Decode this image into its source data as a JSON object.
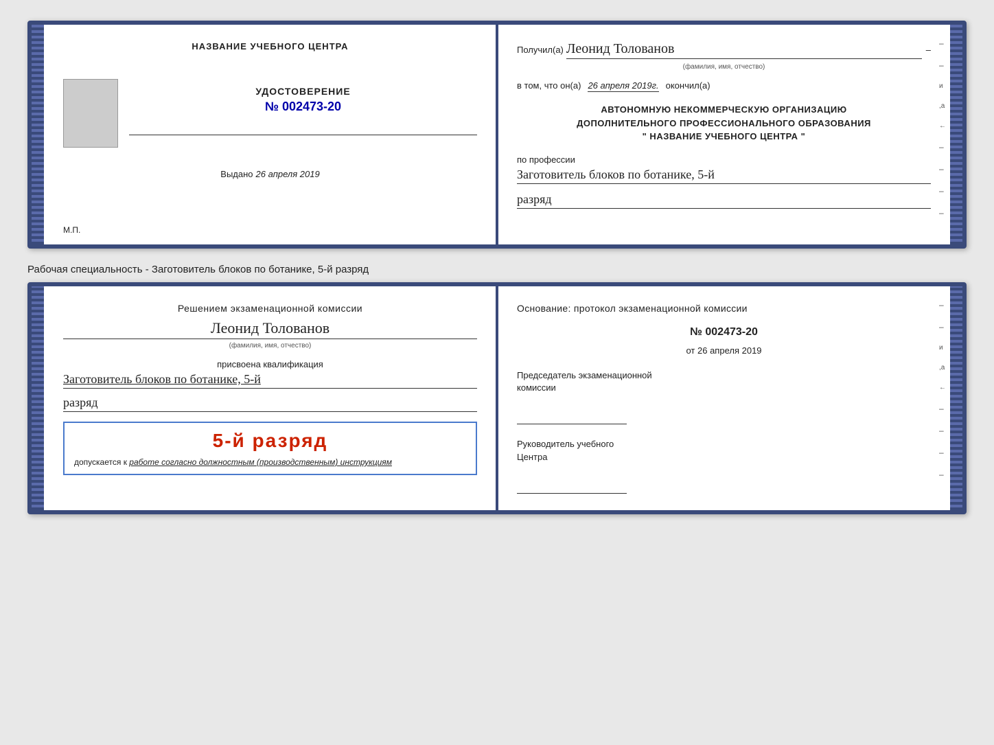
{
  "page": {
    "specialty_text": "Рабочая специальность - Заготовитель блоков по ботанике, 5-й разряд"
  },
  "cert1": {
    "left": {
      "center_name": "НАЗВАНИЕ УЧЕБНОГО ЦЕНТРА",
      "udostoverenie_title": "УДОСТОВЕРЕНИЕ",
      "number": "№ 002473-20",
      "vydano_label": "Выдано",
      "vydano_date": "26 апреля 2019",
      "mp": "М.П."
    },
    "right": {
      "poluchil_label": "Получил(а)",
      "fio_name": "Леонид Толованов",
      "fio_subtitle": "(фамилия, имя, отчество)",
      "v_tom_label": "в том, что он(а)",
      "v_tom_date": "26 апреля 2019г.",
      "okonchil_label": "окончил(а)",
      "autonomnuyu_line1": "АВТОНОМНУЮ НЕКОММЕРЧЕСКУЮ ОРГАНИЗАЦИЮ",
      "autonomnuyu_line2": "ДОПОЛНИТЕЛЬНОГО ПРОФЕССИОНАЛЬНОГО ОБРАЗОВАНИЯ",
      "autonomnuyu_line3": "\" НАЗВАНИЕ УЧЕБНОГО ЦЕНТРА \"",
      "po_professii_label": "по профессии",
      "profession_text": "Заготовитель блоков по ботанике, 5-й",
      "razryad_text": "разряд"
    }
  },
  "cert2": {
    "left": {
      "resheniem_title": "Решением экзаменационной комиссии",
      "fio_name": "Леонид Толованов",
      "fio_subtitle": "(фамилия, имя, отчество)",
      "prisvoena_label": "присвоена квалификация",
      "kvali_text": "Заготовитель блоков по ботанике, 5-й",
      "razryad_text": "разряд",
      "stamp_rank": "5-й разряд",
      "dopuskaetsya_label": "допускается к",
      "dopuskaetsya_italic": "работе согласно должностным (производственным) инструкциям"
    },
    "right": {
      "osnovanie_title": "Основание: протокол экзаменационной комиссии",
      "protokol_number": "№ 002473-20",
      "ot_label": "от",
      "ot_date": "26 апреля 2019",
      "predsedatel_line1": "Председатель экзаменационной",
      "predsedatel_line2": "комиссии",
      "rukovoditel_line1": "Руководитель учебного",
      "rukovoditel_line2": "Центра"
    }
  }
}
